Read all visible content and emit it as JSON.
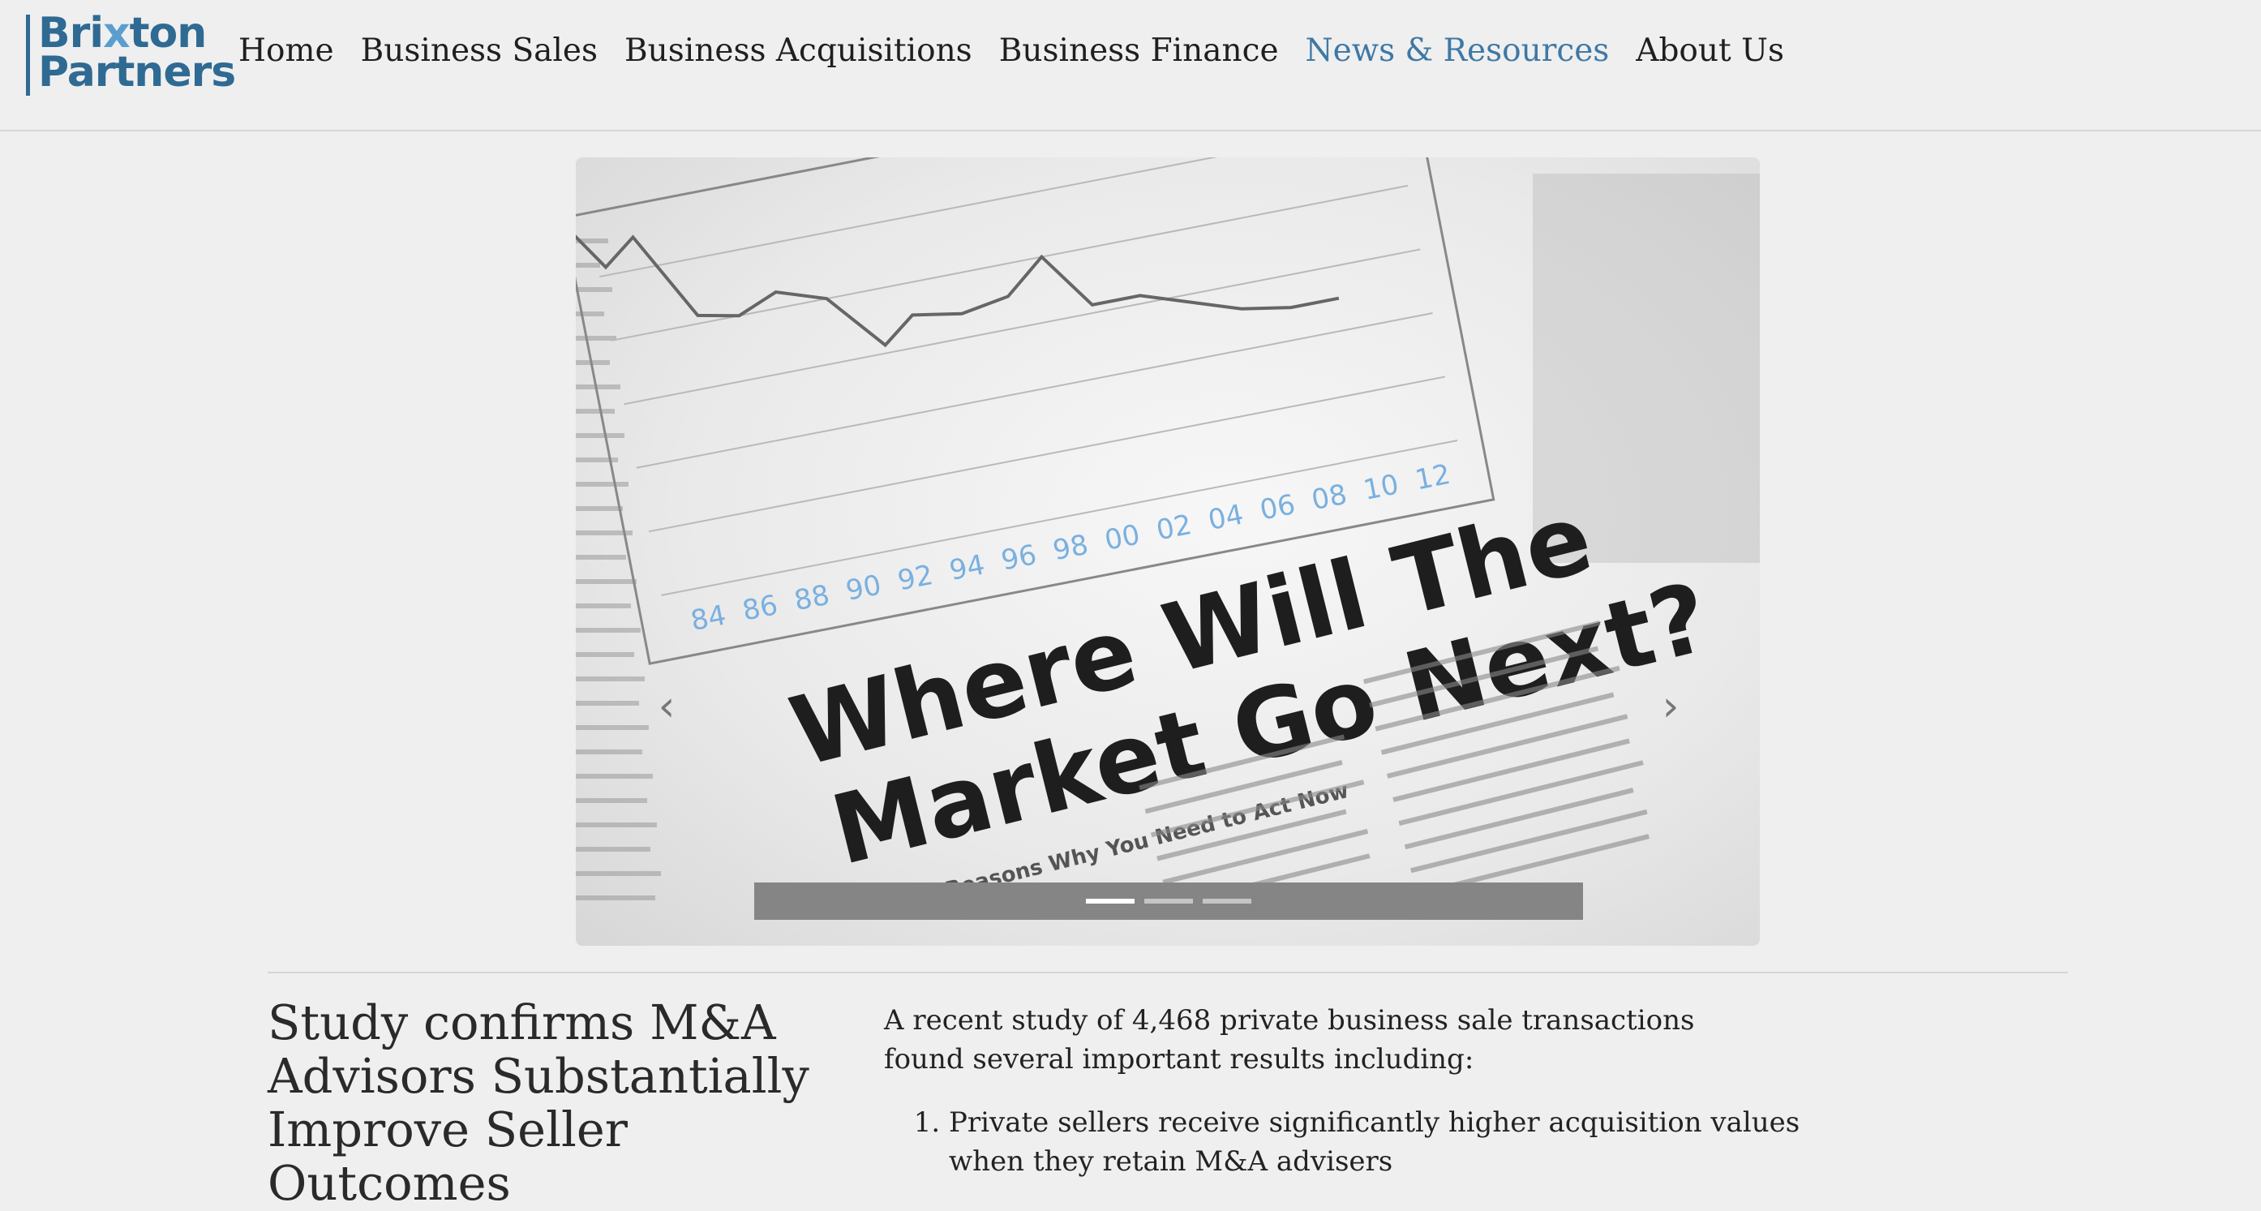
{
  "logo": {
    "line1_a": "Bri",
    "line1_x": "x",
    "line1_b": "ton",
    "line2": "Partners"
  },
  "nav": {
    "items": [
      "Home",
      "Business Sales",
      "Business Acquisitions",
      "Business Finance",
      "News & Resources",
      "About Us"
    ],
    "active": "News & Resources"
  },
  "carousel": {
    "slide_headline_line1": "Where Will The",
    "slide_headline_line2": "Market Go Next?",
    "slide_subhead": "Eight Reasons Why You Need to Act Now",
    "slide_axis_years": [
      "84",
      "86",
      "88",
      "90",
      "92",
      "94",
      "96",
      "98",
      "00",
      "02",
      "04",
      "06",
      "08",
      "10",
      "12"
    ],
    "prev_icon": "chevron-left-icon",
    "next_icon": "chevron-right-icon",
    "slide_count": 3,
    "active_slide": 1
  },
  "article": {
    "title": "Study confirms M&A Advisors Substantially Improve Seller Outcomes",
    "intro": "A recent study of 4,468 private business sale transactions found several important results including:",
    "points": [
      "Private sellers receive significantly higher acquisition values when they retain M&A advisers"
    ]
  },
  "colors": {
    "brand": "#2f6a93",
    "active_nav": "#3f78a5",
    "background": "#efefef"
  }
}
